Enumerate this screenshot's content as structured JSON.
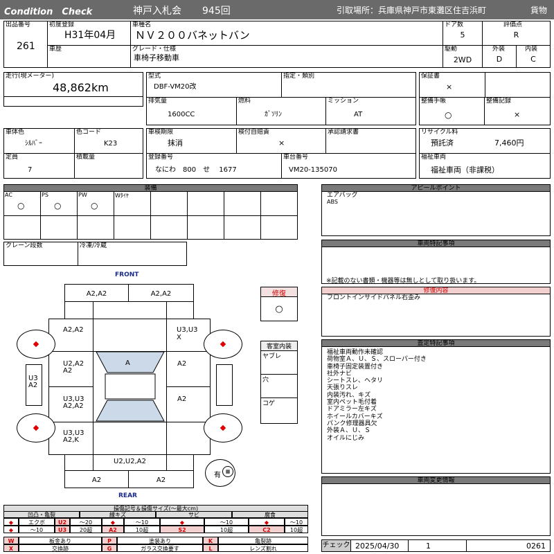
{
  "header": {
    "brand": "Condition　Check",
    "auction": "神戸入札会",
    "session": "945回",
    "pickup": "引取場所：兵庫県神戸市東灘区住吉浜町",
    "category": "貨物"
  },
  "vehicle": {
    "lot_label": "出品番号",
    "lot": "261",
    "first_reg_label": "初度登録",
    "first_reg": "H31年04月",
    "name_label": "車種名",
    "name": "ＮＶ２００バネットバン",
    "doors_label": "ドア数",
    "doors": "5",
    "grade_score_label": "評価点",
    "grade_score": "R",
    "history_label": "車歴",
    "grade_label": "グレード・仕様",
    "grade": "車椅子移動車",
    "drive_label": "駆動",
    "drive": "2WD",
    "exterior_label": "外装",
    "exterior": "D",
    "interior_label": "内装",
    "interior": "C",
    "mileage_label": "走行(現メーター)",
    "mileage": "48,862km",
    "model_label": "型式",
    "model": "DBF-VM20改",
    "designation_label": "指定・類別",
    "warranty_label": "保証書",
    "warranty": "×",
    "displacement_label": "排気量",
    "displacement": "1600CC",
    "fuel_label": "燃料",
    "fuel": "ｶﾞｿﾘﾝ",
    "mission_label": "ミッション",
    "mission": "AT",
    "manual_label": "整備手帳",
    "manual": "○",
    "records_label": "整備記録",
    "records": "×",
    "color_label": "車体色",
    "color": "ｼﾙﾊﾞｰ",
    "color_code_label": "色コード",
    "color_code": "K23",
    "inspection_label": "車検期限",
    "inspection": "抹消",
    "insurance_label": "検付自賠責",
    "insurance": "×",
    "approval_label": "承認請求書",
    "recycle_label": "リサイクル料",
    "recycle_status": "預託済",
    "recycle_fee": "7,460円",
    "capacity_label": "定員",
    "capacity": "7",
    "load_label": "積載量",
    "reg_no_label": "登録番号",
    "reg_no": "なにわ　800　せ　 1677",
    "chassis_label": "車台番号",
    "chassis": "VM20-135070",
    "welfare_label": "福祉車両",
    "welfare": "福祉車両（非課税）"
  },
  "equipment": {
    "title": "装備",
    "items": [
      {
        "label": "AC",
        "value": "○"
      },
      {
        "label": "PS",
        "value": "○"
      },
      {
        "label": "PW",
        "value": "○"
      },
      {
        "label": "Wﾀｲﾔ",
        "value": ""
      }
    ],
    "crane_label": "クレーン段数",
    "fridge_label": "冷凍/冷蔵"
  },
  "diagram": {
    "front": "FRONT",
    "rear": "REAR",
    "cells": {
      "front_left_top": "A2,A2",
      "front_right_top": "A2,A2",
      "left_fender": "A2,A2",
      "right_fender_a": "U3,U3",
      "right_fender_b": "X",
      "left_door1_a": "U2,A2",
      "left_door1_b": "A2",
      "windshield": "A",
      "right_door1": "A2",
      "left_side_a": "U3",
      "left_side_b": "A2",
      "left_door2_a": "U3,U3",
      "left_door2_b": "A2,A2",
      "right_door2": "A2",
      "left_rear_a": "U3,U3",
      "left_rear_b": "A2,K",
      "rear_bumper": "U2,U2,A2",
      "rear_left": "A2",
      "rear_right": "A2"
    },
    "spare_label": "有"
  },
  "repair": {
    "title": "修復",
    "value": "○"
  },
  "cabin": {
    "title": "客室内装",
    "items": [
      "ヤブレ",
      "穴",
      "コゲ"
    ]
  },
  "appeal": {
    "title": "アピールポイント",
    "lines": [
      "エアバッグ",
      "ABS"
    ]
  },
  "special": {
    "title": "車両特記事項",
    "note": "※記載のない書類・機器等は無しとして取り扱います。"
  },
  "repair_detail": {
    "title": "修復内容",
    "text": "フロントインサイドパネル右歪み"
  },
  "inspection_notes": {
    "title": "査定特記事項",
    "lines": [
      "福祉車両動作未確認",
      "荷物室Ａ、Ｕ、Ｓ、スローパー付き",
      "車椅子固定装置付き",
      "社外ナビ",
      "シートスレ、ヘタリ",
      "天張りスレ",
      "内装汚れ、キズ",
      "室内ペット毛付着",
      "ドアミラー左キズ",
      "ホイールカバーキズ",
      "パンク修理器具欠",
      "外装Ａ、Ｕ、Ｓ",
      "オイルにじみ"
    ]
  },
  "changes": {
    "title": "車両変更情報"
  },
  "legend": {
    "title": "損傷記号＆損傷サイズ(〜最大cm)",
    "groups": [
      "凹凸・亀裂",
      "線キズ",
      "サビ",
      "腐食"
    ],
    "row1": [
      "◆",
      "エクボ",
      "U2",
      "〜20",
      "◆",
      "〜10",
      "◆",
      "〜10",
      "◆",
      "〜10"
    ],
    "row2": [
      "◆",
      "〜10",
      "U3",
      "20超",
      "A2",
      "10超",
      "S2",
      "10超",
      "C2",
      "10超"
    ],
    "codes": [
      {
        "code": "W",
        "text": "板金あり",
        "code2": "P",
        "text2": "塗装あり",
        "code3": "K",
        "text3": "亀裂跡"
      },
      {
        "code": "X",
        "text": "交換跡",
        "code2": "G",
        "text2": "ガラス交換要す",
        "code3": "L",
        "text3": "レンズ割れ"
      }
    ]
  },
  "check": {
    "label": "チェック",
    "date": "2025/04/30",
    "count": "1",
    "lot": "0261"
  }
}
